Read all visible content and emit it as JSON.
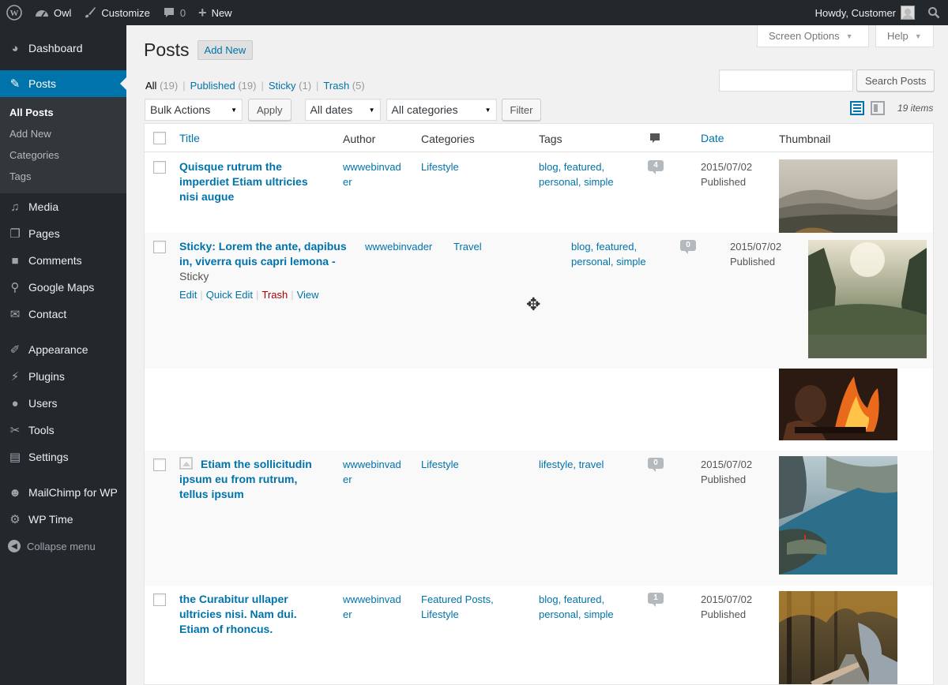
{
  "adminbar": {
    "site_name": "Owl",
    "customize": "Customize",
    "comments_count": "0",
    "new": "New",
    "howdy": "Howdy, Customer"
  },
  "menu": {
    "dashboard": "Dashboard",
    "posts": "Posts",
    "posts_sub": [
      "All Posts",
      "Add New",
      "Categories",
      "Tags"
    ],
    "media": "Media",
    "pages": "Pages",
    "comments": "Comments",
    "google_maps": "Google Maps",
    "contact": "Contact",
    "appearance": "Appearance",
    "plugins": "Plugins",
    "users": "Users",
    "tools": "Tools",
    "settings": "Settings",
    "mailchimp": "MailChimp for WP",
    "wp_time": "WP Time",
    "collapse": "Collapse menu"
  },
  "screen_meta": {
    "screen_options": "Screen Options",
    "help": "Help"
  },
  "heading": {
    "title": "Posts",
    "add_new": "Add New"
  },
  "views": {
    "all": "All",
    "all_count": "(19)",
    "published": "Published",
    "published_count": "(19)",
    "sticky": "Sticky",
    "sticky_count": "(1)",
    "trash": "Trash",
    "trash_count": "(5)"
  },
  "search": {
    "button": "Search Posts",
    "value": ""
  },
  "filters": {
    "bulk_actions": "Bulk Actions",
    "apply": "Apply",
    "dates": "All dates",
    "categories": "All categories",
    "filter": "Filter",
    "items": "19 items"
  },
  "columns": {
    "title": "Title",
    "author": "Author",
    "categories": "Categories",
    "tags": "Tags",
    "date": "Date",
    "thumbnail": "Thumbnail"
  },
  "rows": [
    {
      "title_lines": [
        "Quisque rutrum the",
        "imperdiet Etiam ultricies",
        "nisi augue"
      ],
      "author_lines": [
        "wwwebinvad",
        "er"
      ],
      "categories": "Lifestyle",
      "tags_lines": [
        "blog, featured,",
        "personal, simple"
      ],
      "comments": "4",
      "date": "2015/07/02",
      "status": "Published"
    },
    {
      "title_lines": [
        "Sticky: Lorem the ante, dapibus",
        "in, viverra quis capri lemona -"
      ],
      "post_state": "Sticky",
      "actions": {
        "edit": "Edit",
        "quick_edit": "Quick Edit",
        "trash": "Trash",
        "view": "View"
      },
      "author": "wwwebinvader",
      "categories": "Travel",
      "tags_lines": [
        "blog, featured,",
        "personal, simple"
      ],
      "comments": "0",
      "date": "2015/07/02",
      "status": "Published"
    },
    {
      "title_lines": [
        "Etiam the sollicitudin",
        "ipsum eu from rutrum,",
        "tellus ipsum"
      ],
      "author_lines": [
        "wwwebinvad",
        "er"
      ],
      "categories": "Lifestyle",
      "tags": "lifestyle, travel",
      "comments": "0",
      "date": "2015/07/02",
      "status": "Published"
    },
    {
      "title_lines": [
        "the Curabitur ullaper",
        "ultricies nisi. Nam dui.",
        "Etiam of rhoncus."
      ],
      "author_lines": [
        "wwwebinvad",
        "er"
      ],
      "categories_lines": [
        "Featured Posts,",
        "Lifestyle"
      ],
      "tags_lines": [
        "blog, featured,",
        "personal, simple"
      ],
      "comments": "1",
      "date": "2015/07/02",
      "status": "Published"
    }
  ],
  "colors": {
    "accent": "#0073aa",
    "adminbar": "#23282d",
    "submenu": "#32373c",
    "trash": "#aa0000"
  }
}
